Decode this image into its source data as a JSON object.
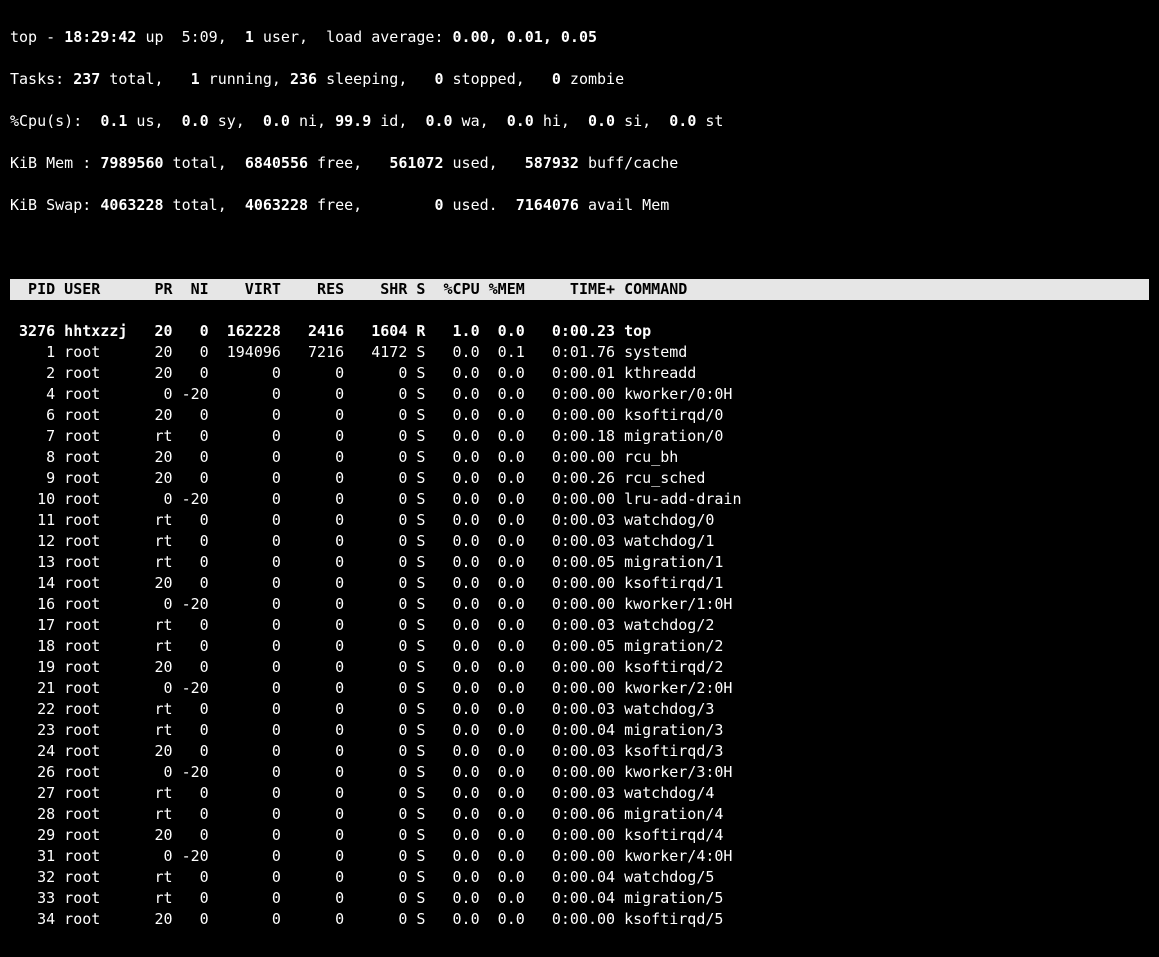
{
  "summary": {
    "line1": {
      "pre": "top - ",
      "time": "18:29:42",
      "up": " up  5:09,  ",
      "users_n": "1",
      "users_lbl": " user,  load average: ",
      "la": "0.00, 0.01, 0.05"
    },
    "tasks": {
      "lbl": "Tasks: ",
      "total": "237",
      "total_lbl": " total,   ",
      "run": "1",
      "run_lbl": " running, ",
      "sleep": "236",
      "sleep_lbl": " sleeping,   ",
      "stop": "0",
      "stop_lbl": " stopped,   ",
      "zom": "0",
      "zom_lbl": " zombie"
    },
    "cpu": {
      "lbl": "%Cpu(s):  ",
      "us": "0.1",
      "us_l": " us,  ",
      "sy": "0.0",
      "sy_l": " sy,  ",
      "ni": "0.0",
      "ni_l": " ni, ",
      "id": "99.9",
      "id_l": " id,  ",
      "wa": "0.0",
      "wa_l": " wa,  ",
      "hi": "0.0",
      "hi_l": " hi,  ",
      "si": "0.0",
      "si_l": " si,  ",
      "st": "0.0",
      "st_l": " st"
    },
    "mem": {
      "lbl": "KiB Mem : ",
      "total": "7989560",
      "total_l": " total,  ",
      "free": "6840556",
      "free_l": " free,   ",
      "used": "561072",
      "used_l": " used,   ",
      "cache": "587932",
      "cache_l": " buff/cache"
    },
    "swap": {
      "lbl": "KiB Swap: ",
      "total": "4063228",
      "total_l": " total,  ",
      "free": "4063228",
      "free_l": " free,        ",
      "used": "0",
      "used_l": " used.  ",
      "avail": "7164076",
      "avail_l": " avail Mem"
    }
  },
  "columns": "  PID USER      PR  NI    VIRT    RES    SHR S  %CPU %MEM     TIME+ COMMAND                                                                ",
  "rows": [
    {
      "pid": "3276",
      "user": "hhtxzzj",
      "pr": "20",
      "ni": "0",
      "virt": "162228",
      "res": "2416",
      "shr": "1604",
      "s": "R",
      "cpu": "1.0",
      "mem": "0.0",
      "time": "0:00.23",
      "cmd": "top",
      "hi": true
    },
    {
      "pid": "1",
      "user": "root",
      "pr": "20",
      "ni": "0",
      "virt": "194096",
      "res": "7216",
      "shr": "4172",
      "s": "S",
      "cpu": "0.0",
      "mem": "0.1",
      "time": "0:01.76",
      "cmd": "systemd"
    },
    {
      "pid": "2",
      "user": "root",
      "pr": "20",
      "ni": "0",
      "virt": "0",
      "res": "0",
      "shr": "0",
      "s": "S",
      "cpu": "0.0",
      "mem": "0.0",
      "time": "0:00.01",
      "cmd": "kthreadd"
    },
    {
      "pid": "4",
      "user": "root",
      "pr": "0",
      "ni": "-20",
      "virt": "0",
      "res": "0",
      "shr": "0",
      "s": "S",
      "cpu": "0.0",
      "mem": "0.0",
      "time": "0:00.00",
      "cmd": "kworker/0:0H"
    },
    {
      "pid": "6",
      "user": "root",
      "pr": "20",
      "ni": "0",
      "virt": "0",
      "res": "0",
      "shr": "0",
      "s": "S",
      "cpu": "0.0",
      "mem": "0.0",
      "time": "0:00.00",
      "cmd": "ksoftirqd/0"
    },
    {
      "pid": "7",
      "user": "root",
      "pr": "rt",
      "ni": "0",
      "virt": "0",
      "res": "0",
      "shr": "0",
      "s": "S",
      "cpu": "0.0",
      "mem": "0.0",
      "time": "0:00.18",
      "cmd": "migration/0"
    },
    {
      "pid": "8",
      "user": "root",
      "pr": "20",
      "ni": "0",
      "virt": "0",
      "res": "0",
      "shr": "0",
      "s": "S",
      "cpu": "0.0",
      "mem": "0.0",
      "time": "0:00.00",
      "cmd": "rcu_bh"
    },
    {
      "pid": "9",
      "user": "root",
      "pr": "20",
      "ni": "0",
      "virt": "0",
      "res": "0",
      "shr": "0",
      "s": "S",
      "cpu": "0.0",
      "mem": "0.0",
      "time": "0:00.26",
      "cmd": "rcu_sched"
    },
    {
      "pid": "10",
      "user": "root",
      "pr": "0",
      "ni": "-20",
      "virt": "0",
      "res": "0",
      "shr": "0",
      "s": "S",
      "cpu": "0.0",
      "mem": "0.0",
      "time": "0:00.00",
      "cmd": "lru-add-drain"
    },
    {
      "pid": "11",
      "user": "root",
      "pr": "rt",
      "ni": "0",
      "virt": "0",
      "res": "0",
      "shr": "0",
      "s": "S",
      "cpu": "0.0",
      "mem": "0.0",
      "time": "0:00.03",
      "cmd": "watchdog/0"
    },
    {
      "pid": "12",
      "user": "root",
      "pr": "rt",
      "ni": "0",
      "virt": "0",
      "res": "0",
      "shr": "0",
      "s": "S",
      "cpu": "0.0",
      "mem": "0.0",
      "time": "0:00.03",
      "cmd": "watchdog/1"
    },
    {
      "pid": "13",
      "user": "root",
      "pr": "rt",
      "ni": "0",
      "virt": "0",
      "res": "0",
      "shr": "0",
      "s": "S",
      "cpu": "0.0",
      "mem": "0.0",
      "time": "0:00.05",
      "cmd": "migration/1"
    },
    {
      "pid": "14",
      "user": "root",
      "pr": "20",
      "ni": "0",
      "virt": "0",
      "res": "0",
      "shr": "0",
      "s": "S",
      "cpu": "0.0",
      "mem": "0.0",
      "time": "0:00.00",
      "cmd": "ksoftirqd/1"
    },
    {
      "pid": "16",
      "user": "root",
      "pr": "0",
      "ni": "-20",
      "virt": "0",
      "res": "0",
      "shr": "0",
      "s": "S",
      "cpu": "0.0",
      "mem": "0.0",
      "time": "0:00.00",
      "cmd": "kworker/1:0H"
    },
    {
      "pid": "17",
      "user": "root",
      "pr": "rt",
      "ni": "0",
      "virt": "0",
      "res": "0",
      "shr": "0",
      "s": "S",
      "cpu": "0.0",
      "mem": "0.0",
      "time": "0:00.03",
      "cmd": "watchdog/2"
    },
    {
      "pid": "18",
      "user": "root",
      "pr": "rt",
      "ni": "0",
      "virt": "0",
      "res": "0",
      "shr": "0",
      "s": "S",
      "cpu": "0.0",
      "mem": "0.0",
      "time": "0:00.05",
      "cmd": "migration/2"
    },
    {
      "pid": "19",
      "user": "root",
      "pr": "20",
      "ni": "0",
      "virt": "0",
      "res": "0",
      "shr": "0",
      "s": "S",
      "cpu": "0.0",
      "mem": "0.0",
      "time": "0:00.00",
      "cmd": "ksoftirqd/2"
    },
    {
      "pid": "21",
      "user": "root",
      "pr": "0",
      "ni": "-20",
      "virt": "0",
      "res": "0",
      "shr": "0",
      "s": "S",
      "cpu": "0.0",
      "mem": "0.0",
      "time": "0:00.00",
      "cmd": "kworker/2:0H"
    },
    {
      "pid": "22",
      "user": "root",
      "pr": "rt",
      "ni": "0",
      "virt": "0",
      "res": "0",
      "shr": "0",
      "s": "S",
      "cpu": "0.0",
      "mem": "0.0",
      "time": "0:00.03",
      "cmd": "watchdog/3"
    },
    {
      "pid": "23",
      "user": "root",
      "pr": "rt",
      "ni": "0",
      "virt": "0",
      "res": "0",
      "shr": "0",
      "s": "S",
      "cpu": "0.0",
      "mem": "0.0",
      "time": "0:00.04",
      "cmd": "migration/3"
    },
    {
      "pid": "24",
      "user": "root",
      "pr": "20",
      "ni": "0",
      "virt": "0",
      "res": "0",
      "shr": "0",
      "s": "S",
      "cpu": "0.0",
      "mem": "0.0",
      "time": "0:00.03",
      "cmd": "ksoftirqd/3"
    },
    {
      "pid": "26",
      "user": "root",
      "pr": "0",
      "ni": "-20",
      "virt": "0",
      "res": "0",
      "shr": "0",
      "s": "S",
      "cpu": "0.0",
      "mem": "0.0",
      "time": "0:00.00",
      "cmd": "kworker/3:0H"
    },
    {
      "pid": "27",
      "user": "root",
      "pr": "rt",
      "ni": "0",
      "virt": "0",
      "res": "0",
      "shr": "0",
      "s": "S",
      "cpu": "0.0",
      "mem": "0.0",
      "time": "0:00.03",
      "cmd": "watchdog/4"
    },
    {
      "pid": "28",
      "user": "root",
      "pr": "rt",
      "ni": "0",
      "virt": "0",
      "res": "0",
      "shr": "0",
      "s": "S",
      "cpu": "0.0",
      "mem": "0.0",
      "time": "0:00.06",
      "cmd": "migration/4"
    },
    {
      "pid": "29",
      "user": "root",
      "pr": "20",
      "ni": "0",
      "virt": "0",
      "res": "0",
      "shr": "0",
      "s": "S",
      "cpu": "0.0",
      "mem": "0.0",
      "time": "0:00.00",
      "cmd": "ksoftirqd/4"
    },
    {
      "pid": "31",
      "user": "root",
      "pr": "0",
      "ni": "-20",
      "virt": "0",
      "res": "0",
      "shr": "0",
      "s": "S",
      "cpu": "0.0",
      "mem": "0.0",
      "time": "0:00.00",
      "cmd": "kworker/4:0H"
    },
    {
      "pid": "32",
      "user": "root",
      "pr": "rt",
      "ni": "0",
      "virt": "0",
      "res": "0",
      "shr": "0",
      "s": "S",
      "cpu": "0.0",
      "mem": "0.0",
      "time": "0:00.04",
      "cmd": "watchdog/5"
    },
    {
      "pid": "33",
      "user": "root",
      "pr": "rt",
      "ni": "0",
      "virt": "0",
      "res": "0",
      "shr": "0",
      "s": "S",
      "cpu": "0.0",
      "mem": "0.0",
      "time": "0:00.04",
      "cmd": "migration/5"
    },
    {
      "pid": "34",
      "user": "root",
      "pr": "20",
      "ni": "0",
      "virt": "0",
      "res": "0",
      "shr": "0",
      "s": "S",
      "cpu": "0.0",
      "mem": "0.0",
      "time": "0:00.00",
      "cmd": "ksoftirqd/5"
    }
  ]
}
